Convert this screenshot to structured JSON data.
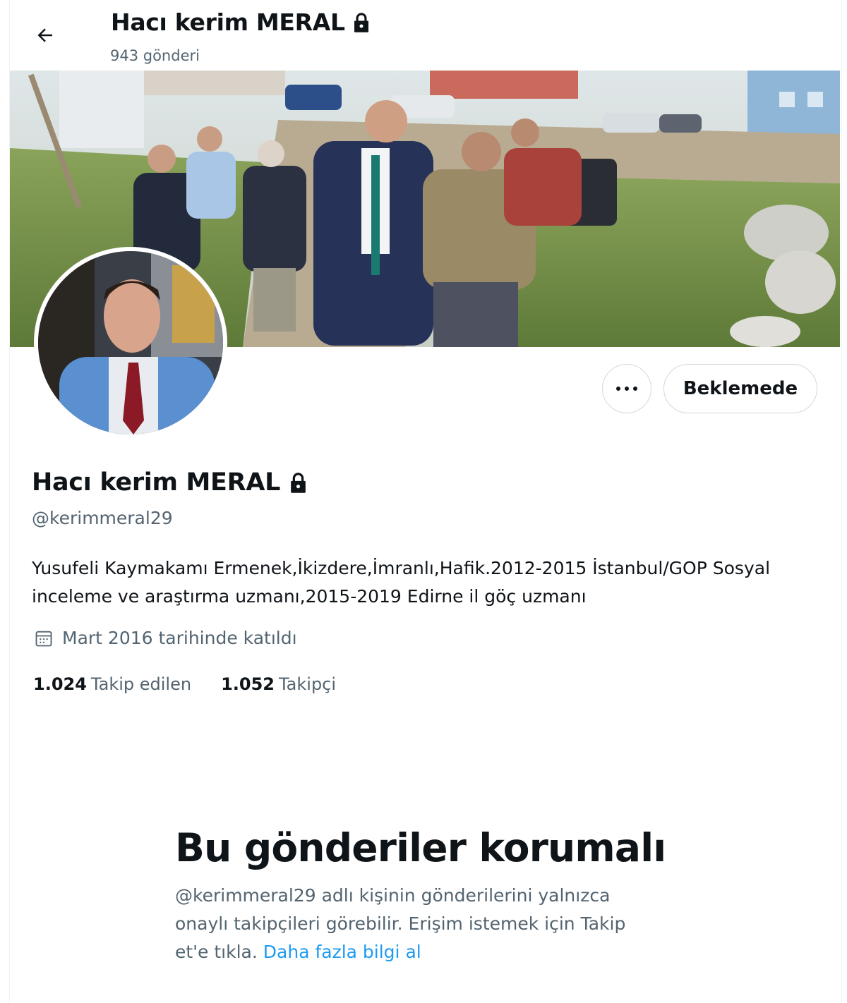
{
  "header": {
    "name": "Hacı kerim MERAL",
    "post_count": "943 gönderi"
  },
  "actions": {
    "pending_label": "Beklemede"
  },
  "profile": {
    "name": "Hacı kerim MERAL",
    "handle": "@kerimmeral29",
    "bio": "Yusufeli Kaymakamı Ermenek,İkizdere,İmranlı,Hafik.2012-2015 İstanbul/GOP Sosyal inceleme ve araştırma uzmanı,2015-2019 Edirne il göç uzmanı",
    "joined": "Mart 2016 tarihinde katıldı",
    "following_count": "1.024",
    "following_label": "Takip edilen",
    "followers_count": "1.052",
    "followers_label": "Takipçi"
  },
  "protected": {
    "title": "Bu gönderiler korumalı",
    "text": "@kerimmeral29 adlı kişinin gönderilerini yalnızca onaylı takipçileri görebilir. Erişim istemek için Takip et'e tıkla.",
    "link": "Daha fazla bilgi al"
  },
  "icons": {
    "back": "arrow-left-icon",
    "lock": "lock-icon",
    "calendar": "calendar-icon",
    "more": "more-icon"
  },
  "colors": {
    "text": "#0f1419",
    "secondary": "#536471",
    "link": "#1d9bf0",
    "border": "#cfd9de"
  }
}
